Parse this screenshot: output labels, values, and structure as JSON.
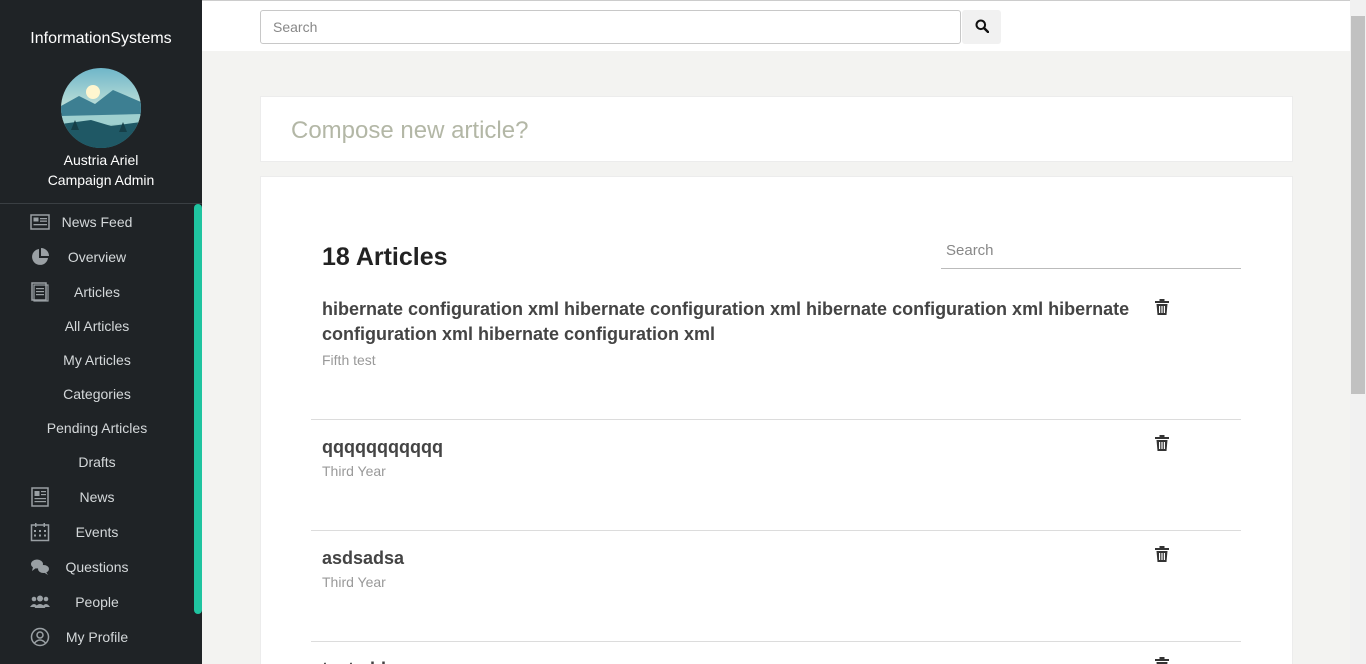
{
  "sidebar": {
    "brand": "InformationSystems",
    "user_name": "Austria Ariel",
    "user_role": "Campaign Admin",
    "nav": [
      {
        "label": "News Feed",
        "icon": "newspaper-icon"
      },
      {
        "label": "Overview",
        "icon": "pie-chart-icon"
      },
      {
        "label": "Articles",
        "icon": "document-icon"
      }
    ],
    "sub_nav": [
      {
        "label": "All Articles"
      },
      {
        "label": "My Articles"
      },
      {
        "label": "Categories"
      },
      {
        "label": "Pending Articles"
      },
      {
        "label": "Drafts"
      }
    ],
    "nav2": [
      {
        "label": "News",
        "icon": "news-icon"
      },
      {
        "label": "Events",
        "icon": "calendar-icon"
      },
      {
        "label": "Questions",
        "icon": "chat-icon"
      },
      {
        "label": "People",
        "icon": "people-icon"
      },
      {
        "label": "My Profile",
        "icon": "user-circle-icon"
      }
    ]
  },
  "topbar": {
    "search_placeholder": "Search"
  },
  "compose": {
    "placeholder": "Compose new article?"
  },
  "articles": {
    "count_label": "18 Articles",
    "search_placeholder": "Search",
    "items": [
      {
        "title": "hibernate configuration xml hibernate configuration xml hibernate configuration xml hibernate configuration xml hibernate configuration xml",
        "category": "Fifth test"
      },
      {
        "title": "qqqqqqqqqqq",
        "category": "Third Year"
      },
      {
        "title": "asdsadsa",
        "category": "Third Year"
      },
      {
        "title": "testadd",
        "category": ""
      }
    ]
  },
  "colors": {
    "sidebar_bg": "#1f2326",
    "accent": "#1fc4a0",
    "compose_text": "#b3b7a6"
  }
}
